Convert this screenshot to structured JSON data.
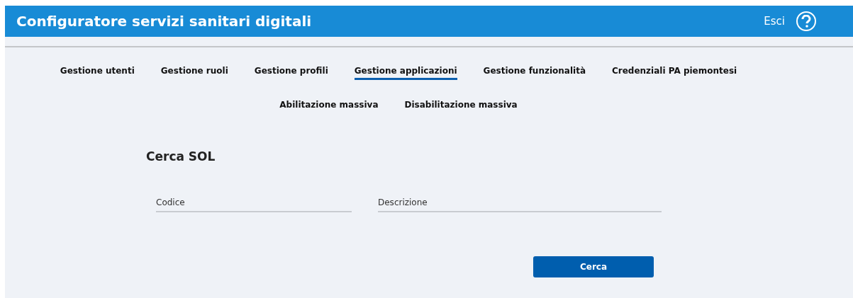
{
  "header": {
    "title": "Configuratore servizi sanitari digitali",
    "logout": "Esci"
  },
  "tabs": [
    {
      "label": "Gestione utenti",
      "selected": false
    },
    {
      "label": "Gestione ruoli",
      "selected": false
    },
    {
      "label": "Gestione profili",
      "selected": false
    },
    {
      "label": "Gestione applicazioni",
      "selected": true
    },
    {
      "label": "Gestione funzionalità",
      "selected": false
    },
    {
      "label": "Credenziali PA piemontesi",
      "selected": false
    },
    {
      "label": "Abilitazione massiva",
      "selected": false
    },
    {
      "label": "Disabilitazione massiva",
      "selected": false
    }
  ],
  "form": {
    "title": "Cerca SOL",
    "fields": [
      {
        "placeholder": "Codice"
      },
      {
        "placeholder": "Descrizione"
      }
    ],
    "button": "Cerca"
  }
}
